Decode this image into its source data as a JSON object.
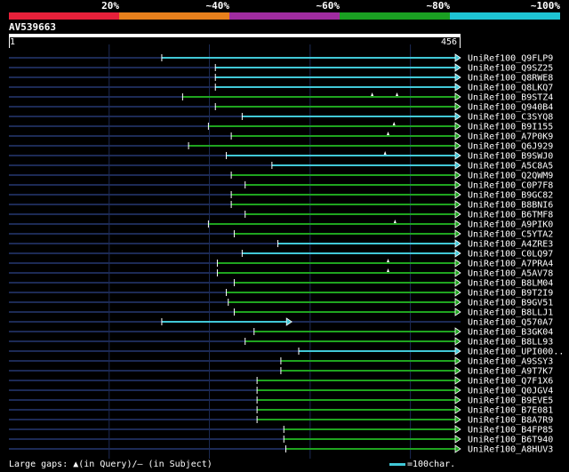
{
  "legend": {
    "labels": [
      "20%",
      "~40%",
      "~60%",
      "~80%",
      "~100%"
    ],
    "colors": [
      "#e8203a",
      "#e8801c",
      "#a02ca0",
      "#1aa022",
      "#1ec4d4"
    ]
  },
  "query": {
    "name": "AV539663",
    "start": "1",
    "end": "456",
    "length": 456
  },
  "colors": {
    "cyan": "#41c8d7",
    "green": "#1fa41f",
    "dim": "#1c2a55",
    "grid": "#1c2a55"
  },
  "grid_fractions": [
    0.222,
    0.444,
    0.667,
    0.889
  ],
  "hits": [
    {
      "name": "UniRef100_Q9FLP9",
      "start": 155,
      "end": 456,
      "color": "cyan",
      "gaps": []
    },
    {
      "name": "UniRef100_Q9SZ25",
      "start": 209,
      "end": 456,
      "color": "cyan",
      "gaps": []
    },
    {
      "name": "UniRef100_Q8RWE8",
      "start": 209,
      "end": 456,
      "color": "cyan",
      "gaps": []
    },
    {
      "name": "UniRef100_Q8LKQ7",
      "start": 209,
      "end": 456,
      "color": "cyan",
      "gaps": []
    },
    {
      "name": "UniRef100_B9STZ4",
      "start": 176,
      "end": 456,
      "color": "green",
      "gaps": [
        367,
        392
      ]
    },
    {
      "name": "UniRef100_Q940B4",
      "start": 209,
      "end": 456,
      "color": "green",
      "gaps": []
    },
    {
      "name": "UniRef100_C3SYQ8",
      "start": 236,
      "end": 456,
      "color": "cyan",
      "gaps": []
    },
    {
      "name": "UniRef100_B9I155",
      "start": 202,
      "end": 456,
      "color": "green",
      "gaps": [
        389
      ]
    },
    {
      "name": "UniRef100_A7P0K9",
      "start": 225,
      "end": 456,
      "color": "green",
      "gaps": [
        383
      ]
    },
    {
      "name": "UniRef100_Q6J929",
      "start": 182,
      "end": 456,
      "color": "green",
      "gaps": []
    },
    {
      "name": "UniRef100_B9SWJ0",
      "start": 220,
      "end": 456,
      "color": "cyan",
      "gaps": [
        380
      ]
    },
    {
      "name": "UniRef100_A5C8A5",
      "start": 266,
      "end": 456,
      "color": "cyan",
      "gaps": []
    },
    {
      "name": "UniRef100_Q2QWM9",
      "start": 225,
      "end": 456,
      "color": "green",
      "gaps": []
    },
    {
      "name": "UniRef100_C0P7F8",
      "start": 239,
      "end": 456,
      "color": "green",
      "gaps": []
    },
    {
      "name": "UniRef100_B9GC82",
      "start": 225,
      "end": 456,
      "color": "green",
      "gaps": []
    },
    {
      "name": "UniRef100_B8BNI6",
      "start": 225,
      "end": 456,
      "color": "green",
      "gaps": []
    },
    {
      "name": "UniRef100_B6TMF8",
      "start": 239,
      "end": 456,
      "color": "green",
      "gaps": []
    },
    {
      "name": "UniRef100_A9PIK0",
      "start": 202,
      "end": 456,
      "color": "green",
      "gaps": [
        390
      ]
    },
    {
      "name": "UniRef100_C5YTA2",
      "start": 228,
      "end": 456,
      "color": "green",
      "gaps": []
    },
    {
      "name": "UniRef100_A4ZRE3",
      "start": 272,
      "end": 456,
      "color": "cyan",
      "gaps": []
    },
    {
      "name": "UniRef100_C0LQ97",
      "start": 236,
      "end": 456,
      "color": "cyan",
      "gaps": []
    },
    {
      "name": "UniRef100_A7PRA4",
      "start": 211,
      "end": 456,
      "color": "green",
      "gaps": [
        383
      ]
    },
    {
      "name": "UniRef100_A5AV78",
      "start": 211,
      "end": 456,
      "color": "green",
      "gaps": [
        383
      ]
    },
    {
      "name": "UniRef100_B8LM04",
      "start": 228,
      "end": 456,
      "color": "green",
      "gaps": []
    },
    {
      "name": "UniRef100_B9T2I9",
      "start": 220,
      "end": 456,
      "color": "green",
      "gaps": []
    },
    {
      "name": "UniRef100_B9GV51",
      "start": 222,
      "end": 456,
      "color": "green",
      "gaps": []
    },
    {
      "name": "UniRef100_B8LLJ1",
      "start": 228,
      "end": 456,
      "color": "green",
      "gaps": []
    },
    {
      "name": "UniRef100_Q570A7",
      "start": 155,
      "end": 286,
      "color": "cyan",
      "gaps": []
    },
    {
      "name": "UniRef100_B3GK04",
      "start": 248,
      "end": 456,
      "color": "green",
      "gaps": []
    },
    {
      "name": "UniRef100_B8LL93",
      "start": 239,
      "end": 456,
      "color": "green",
      "gaps": []
    },
    {
      "name": "UniRef100_UPI000..",
      "start": 293,
      "end": 456,
      "color": "cyan",
      "gaps": []
    },
    {
      "name": "UniRef100_A9SSY3",
      "start": 275,
      "end": 456,
      "color": "green",
      "gaps": []
    },
    {
      "name": "UniRef100_A9T7K7",
      "start": 275,
      "end": 456,
      "color": "green",
      "gaps": []
    },
    {
      "name": "UniRef100_Q7F1X6",
      "start": 251,
      "end": 456,
      "color": "green",
      "gaps": []
    },
    {
      "name": "UniRef100_Q0JGV4",
      "start": 251,
      "end": 456,
      "color": "green",
      "gaps": []
    },
    {
      "name": "UniRef100_B9EVE5",
      "start": 251,
      "end": 456,
      "color": "green",
      "gaps": []
    },
    {
      "name": "UniRef100_B7E081",
      "start": 251,
      "end": 456,
      "color": "green",
      "gaps": []
    },
    {
      "name": "UniRef100_B8A7R9",
      "start": 251,
      "end": 456,
      "color": "green",
      "gaps": []
    },
    {
      "name": "UniRef100_B4FP85",
      "start": 278,
      "end": 456,
      "color": "green",
      "gaps": []
    },
    {
      "name": "UniRef100_B6T940",
      "start": 278,
      "end": 456,
      "color": "green",
      "gaps": []
    },
    {
      "name": "UniRef100_A8HUV3",
      "start": 280,
      "end": 456,
      "color": "green",
      "gaps": []
    }
  ],
  "footer": {
    "gaps_text": "Large gaps: ▲(in Query)/– (in Subject)",
    "scale_text": "=100char."
  }
}
